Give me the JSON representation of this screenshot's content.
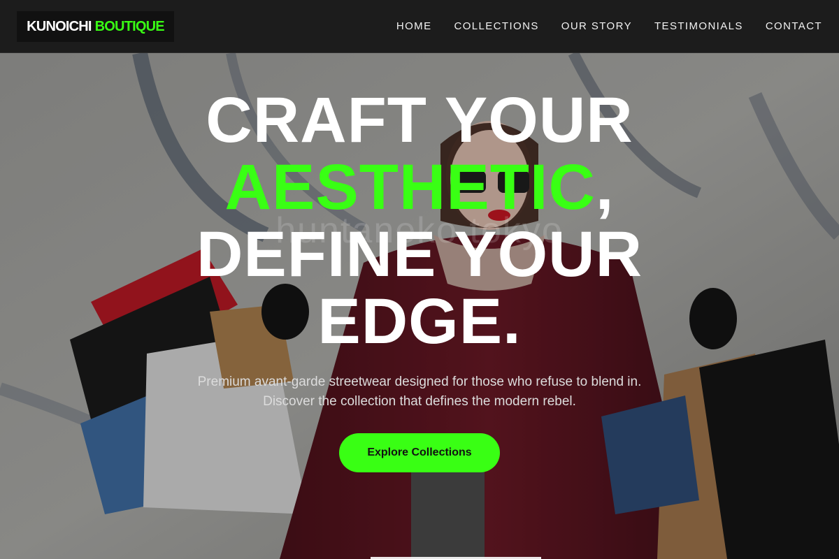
{
  "brand": {
    "name_white": "KUNOICHI",
    "name_green": "BOUTIQUE"
  },
  "nav": {
    "items": [
      {
        "label": "HOME"
      },
      {
        "label": "COLLECTIONS"
      },
      {
        "label": "OUR STORY"
      },
      {
        "label": "TESTIMONIALS"
      },
      {
        "label": "CONTACT"
      }
    ]
  },
  "hero": {
    "headline_line1": "CRAFT YOUR",
    "headline_accent": "AESTHETIC",
    "headline_comma": ",",
    "headline_line3": "DEFINE YOUR",
    "headline_line4": "EDGE.",
    "subtext_line1": "Premium avant-garde streetwear designed for those who refuse to blend in.",
    "subtext_line2": "Discover the collection that defines the modern rebel.",
    "cta_label": "Explore Collections",
    "watermark": "huntaneko tokyo"
  },
  "colors": {
    "accent": "#39ff14",
    "header_bg": "#1c1c1c",
    "logo_bg": "#111111",
    "text": "#ffffff"
  }
}
